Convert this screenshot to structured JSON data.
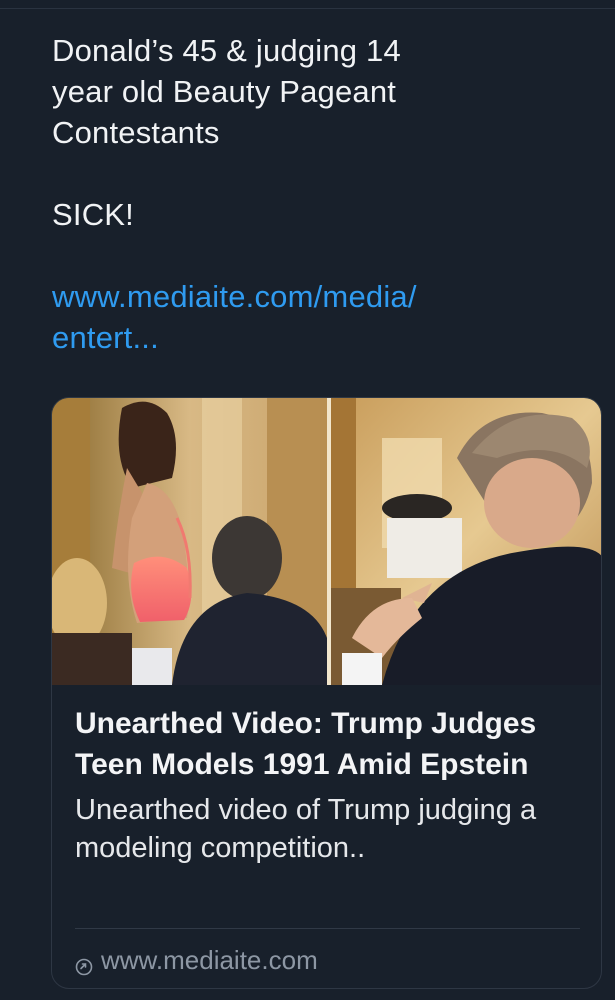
{
  "post": {
    "text_line1": "Donald’s 45 & judging 14",
    "text_line2": "year old Beauty Pageant",
    "text_line3": "Contestants",
    "text_line4": "SICK!",
    "link_line1": "www.mediaite.com/media/",
    "link_line2": "entert..."
  },
  "link_card": {
    "title": "Unearthed Video: Trump Judges Teen Models 1991 Amid Epstein",
    "description": "Unearthed video of Trump judging a modeling competition..",
    "domain": "www.mediaite.com",
    "domain_icon": "link-icon"
  },
  "colors": {
    "background": "#18202b",
    "text": "#f1f3f5",
    "link": "#2f9bf0",
    "muted": "#8d97a4",
    "border": "#2e3744"
  }
}
